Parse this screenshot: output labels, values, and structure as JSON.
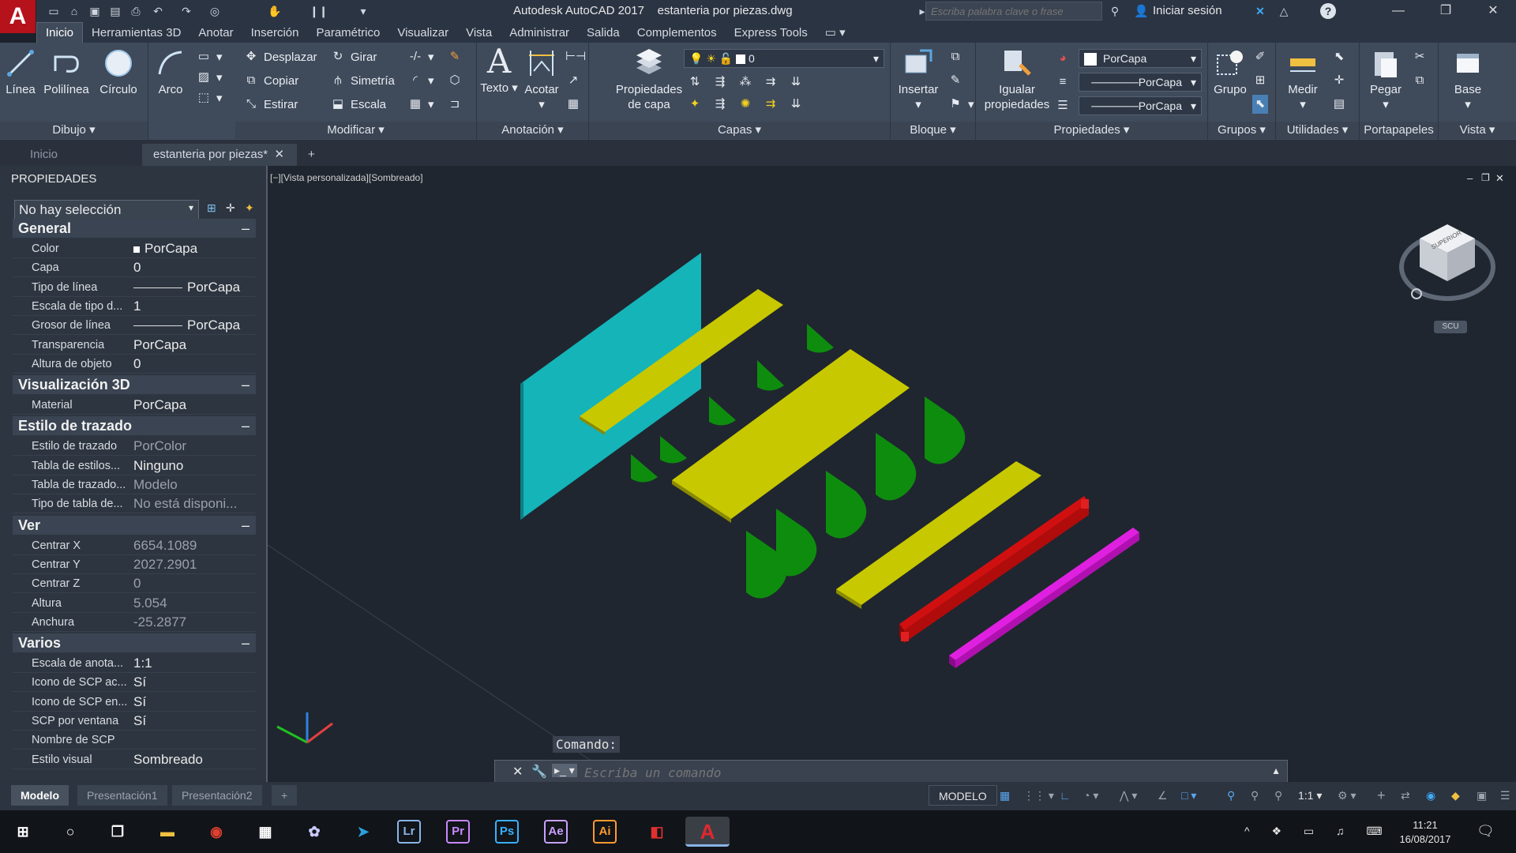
{
  "app": {
    "title": "Autodesk AutoCAD 2017",
    "file": "estanteria por piezas.dwg",
    "logo_letter": "A"
  },
  "search": {
    "placeholder": "Escriba palabra clave o frase",
    "signin": "Iniciar sesión"
  },
  "ribbon_tabs": [
    "Inicio",
    "Herramientas 3D",
    "Anotar",
    "Inserción",
    "Paramétrico",
    "Visualizar",
    "Vista",
    "Administrar",
    "Salida",
    "Complementos",
    "Express Tools"
  ],
  "ribbon": {
    "dibujo": {
      "title": "Dibujo",
      "linea": "Línea",
      "polilinea": "Polilínea",
      "circulo": "Círculo",
      "arco": "Arco"
    },
    "modificar": {
      "title": "Modificar",
      "desplazar": "Desplazar",
      "girar": "Girar",
      "copiar": "Copiar",
      "simetria": "Simetría",
      "estirar": "Estirar",
      "escala": "Escala"
    },
    "anotacion": {
      "title": "Anotación",
      "texto": "Texto",
      "acotar": "Acotar"
    },
    "capas": {
      "title": "Capas",
      "prop_line1": "Propiedades",
      "prop_line2": "de capa",
      "layer_value": "0"
    },
    "bloque": {
      "title": "Bloque",
      "insertar": "Insertar"
    },
    "propiedades": {
      "title": "Propiedades",
      "igualar_line1": "Igualar",
      "igualar_line2": "propiedades",
      "color": "PorCapa",
      "linetype": "PorCapa",
      "lineweight": "PorCapa"
    },
    "grupos": {
      "title": "Grupos",
      "grupo": "Grupo"
    },
    "utilidades": {
      "title": "Utilidades",
      "medir": "Medir"
    },
    "portapapeles": {
      "title": "Portapapeles",
      "pegar": "Pegar"
    },
    "vista": {
      "title": "Vista",
      "base": "Base"
    }
  },
  "doc_tabs": {
    "home": "Inicio",
    "active": "estanteria por piezas*"
  },
  "properties": {
    "title": "PROPIEDADES",
    "selection": "No hay selección",
    "sections": {
      "general": {
        "title": "General",
        "rows": [
          {
            "k": "Color",
            "v": "PorCapa"
          },
          {
            "k": "Capa",
            "v": "0"
          },
          {
            "k": "Tipo de línea",
            "v": "PorCapa"
          },
          {
            "k": "Escala de tipo d...",
            "v": "1"
          },
          {
            "k": "Grosor de línea",
            "v": "PorCapa"
          },
          {
            "k": "Transparencia",
            "v": "PorCapa"
          },
          {
            "k": "Altura de objeto",
            "v": "0"
          }
        ]
      },
      "vis3d": {
        "title": "Visualización 3D",
        "rows": [
          {
            "k": "Material",
            "v": "PorCapa"
          }
        ]
      },
      "trazado": {
        "title": "Estilo de trazado",
        "rows": [
          {
            "k": "Estilo de trazado",
            "v": "PorColor"
          },
          {
            "k": "Tabla de estilos...",
            "v": "Ninguno"
          },
          {
            "k": "Tabla de trazado...",
            "v": "Modelo"
          },
          {
            "k": "Tipo de tabla de...",
            "v": "No está disponi..."
          }
        ]
      },
      "ver": {
        "title": "Ver",
        "rows": [
          {
            "k": "Centrar X",
            "v": "6654.1089"
          },
          {
            "k": "Centrar Y",
            "v": "2027.2901"
          },
          {
            "k": "Centrar Z",
            "v": "0"
          },
          {
            "k": "Altura",
            "v": "5.054"
          },
          {
            "k": "Anchura",
            "v": "-25.2877"
          }
        ]
      },
      "varios": {
        "title": "Varios",
        "rows": [
          {
            "k": "Escala de anota...",
            "v": "1:1"
          },
          {
            "k": "Icono de SCP ac...",
            "v": "Sí"
          },
          {
            "k": "Icono de SCP en...",
            "v": "Sí"
          },
          {
            "k": "SCP por ventana",
            "v": "Sí"
          },
          {
            "k": "Nombre de SCP",
            "v": ""
          },
          {
            "k": "Estilo visual",
            "v": "Sombreado"
          }
        ]
      }
    }
  },
  "viewport": {
    "label": "[−][Vista personalizada][Sombreado]",
    "viewcube_face": "SUPERIOR",
    "scu": "SCU"
  },
  "command": {
    "label": "Comando:",
    "placeholder": "Escriba un comando"
  },
  "layout_tabs": [
    "Modelo",
    "Presentación1",
    "Presentación2"
  ],
  "status": {
    "mode": "MODELO",
    "scale": "1:1"
  },
  "clock": {
    "time": "11:21",
    "date": "16/08/2017"
  },
  "colors": {
    "cyan": "#14b4b9",
    "yellow": "#c8c800",
    "green": "#0e8c0e",
    "red": "#d01010",
    "magenta": "#d010d0"
  }
}
